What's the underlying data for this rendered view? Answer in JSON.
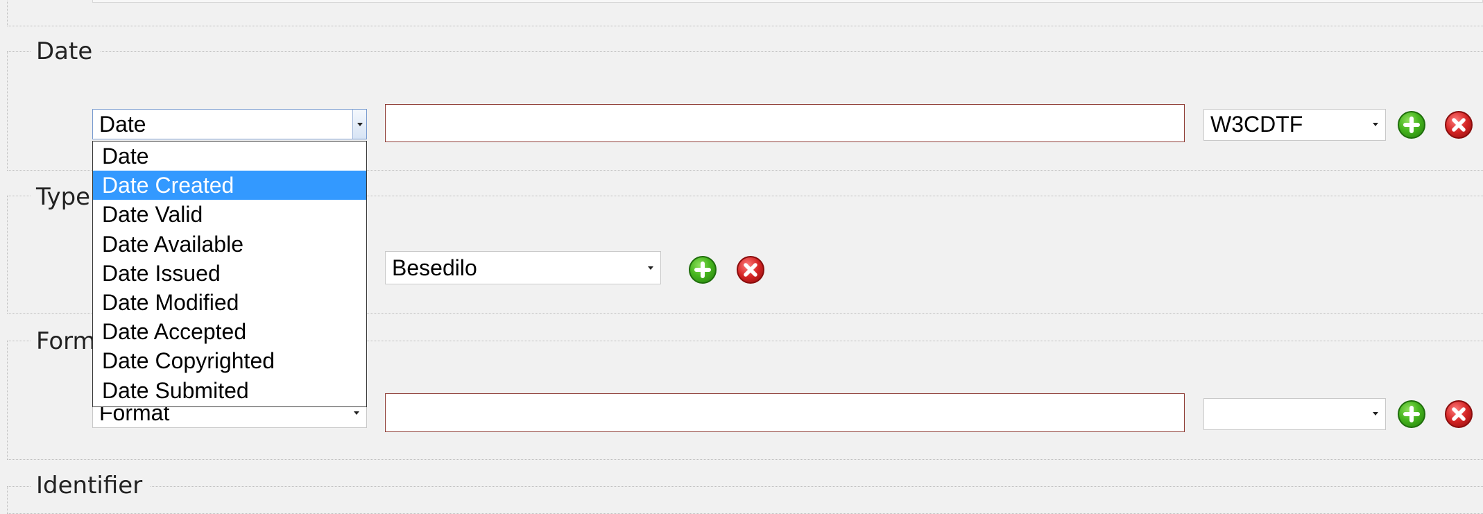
{
  "sections": {
    "date": {
      "legend": "Date"
    },
    "type": {
      "legend": "Type"
    },
    "format": {
      "legend": "Form"
    },
    "identifier": {
      "legend": "Identifier"
    }
  },
  "date_row": {
    "qualifier_select": "Date",
    "value_input": "",
    "scheme_select": "W3CDTF"
  },
  "type_row": {
    "type_select": "Besedilo"
  },
  "format_row": {
    "qualifier_select": "Format",
    "value_input": "",
    "scheme_select": ""
  },
  "dropdown": {
    "options": [
      "Date",
      "Date Created",
      "Date Valid",
      "Date Available",
      "Date Issued",
      "Date Modified",
      "Date Accepted",
      "Date Copyrighted",
      "Date Submited"
    ],
    "highlighted": "Date Created"
  },
  "icons": {
    "add": "plus-circle-icon",
    "remove": "x-circle-icon"
  },
  "colors": {
    "highlight": "#3399ff",
    "add_button": "#47b51f",
    "remove_button": "#d42525",
    "input_border": "#8d3a33"
  }
}
